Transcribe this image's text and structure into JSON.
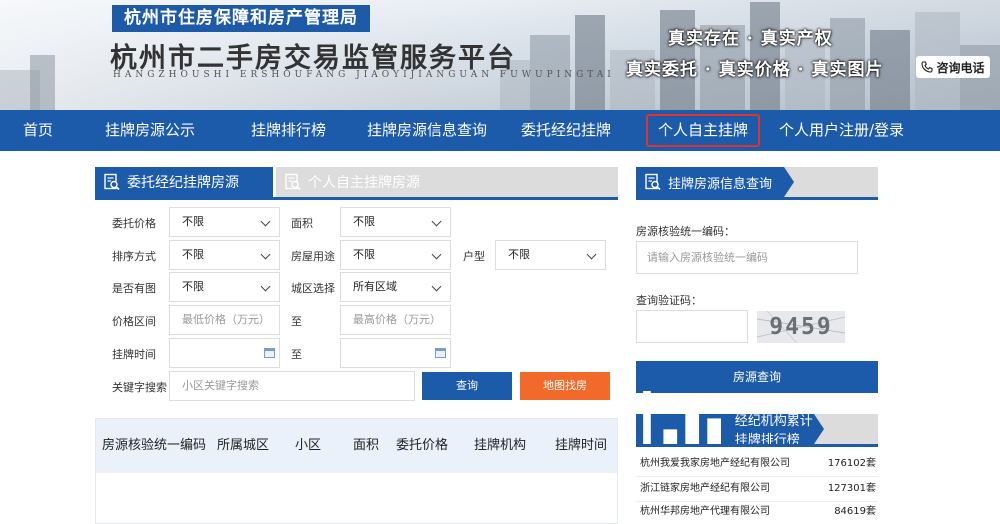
{
  "header": {
    "bureau": "杭州市住房保障和房产管理局",
    "platform_title": "杭州市二手房交易监管服务平台",
    "platform_pinyin": "HANGZHOUSHI ERSHOUFANG JIAOYIJIANGUAN FUWUPINGTAI",
    "slogan_line1": "真实存在 · 真实产权",
    "slogan_line2": "真实委托 · 真实价格 · 真实图片",
    "consult_button": "咨询电话"
  },
  "nav": {
    "items": [
      {
        "label": "首页"
      },
      {
        "label": "挂牌房源公示"
      },
      {
        "label": "挂牌排行榜"
      },
      {
        "label": "挂牌房源信息查询"
      },
      {
        "label": "委托经纪挂牌"
      },
      {
        "label": "个人自主挂牌"
      },
      {
        "label": "个人用户注册/登录"
      }
    ],
    "active": "个人自主挂牌"
  },
  "listing_tabs": {
    "tab1": "委托经纪挂牌房源",
    "tab2": "个人自主挂牌房源"
  },
  "filters": {
    "price_label": "委托价格",
    "price_value": "不限",
    "area_label": "面积",
    "area_value": "不限",
    "sort_label": "排序方式",
    "sort_value": "不限",
    "usage_label": "房屋用途",
    "usage_value": "不限",
    "layout_label": "户型",
    "layout_value": "不限",
    "photo_label": "是否有图",
    "photo_value": "不限",
    "district_label": "城区选择",
    "district_value": "所有区域",
    "price_range_label": "价格区间",
    "price_min_placeholder": "最低价格（万元）",
    "to_label": "至",
    "price_max_placeholder": "最高价格（万元）",
    "listing_time_label": "挂牌时间",
    "to_label2": "至",
    "keyword_label": "关键字搜索",
    "keyword_placeholder": "小区关键字搜索",
    "search_button": "查询",
    "map_button": "地图找房"
  },
  "results_table": {
    "columns": [
      "房源核验统一编码",
      "所属城区",
      "小区",
      "面积",
      "委托价格",
      "挂牌机构",
      "挂牌时间"
    ]
  },
  "right_query": {
    "title": "挂牌房源信息查询",
    "code_label": "房源核验统一编码：",
    "code_placeholder": "请输入房源核验统一编码",
    "captcha_label": "查询验证码：",
    "captcha_text": "9459",
    "query_button": "房源查询"
  },
  "ranking": {
    "title": "经纪机构累计挂牌排行榜",
    "rows": [
      {
        "name": "杭州我爱我家房地产经纪有限公司",
        "count": "176102套"
      },
      {
        "name": "浙江链家房地产经纪有限公司",
        "count": "127301套"
      },
      {
        "name": "杭州华邦房地产代理有限公司",
        "count": "84619套"
      }
    ]
  },
  "colors": {
    "primary_blue": "#1c5aaa",
    "orange": "#f26a2a",
    "active_nav_border": "#e2322b",
    "table_header_bg": "#eaf1fb"
  }
}
